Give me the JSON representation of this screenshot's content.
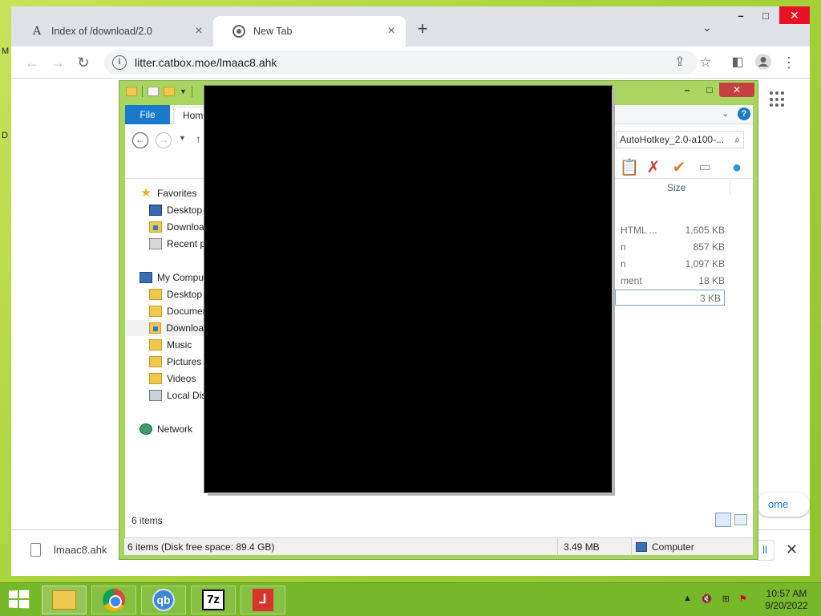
{
  "browser": {
    "tabs": [
      {
        "label": "Index of /download/2.0",
        "favicon": "A"
      },
      {
        "label": "New Tab"
      }
    ],
    "url": "litter.catbox.moe/lmaac8.ahk",
    "customize_label": "ome",
    "download": {
      "filename": "lmaac8.ahk"
    }
  },
  "explorer": {
    "ribbon": {
      "file": "File",
      "home": "Home"
    },
    "address": "AutoHotkey_2.0-a100-...",
    "column_size": "Size",
    "tree": {
      "favorites": "Favorites",
      "fav_desktop": "Desktop",
      "fav_downloads": "Downloa",
      "fav_recent": "Recent pl",
      "computer": "My Compu",
      "desktop": "Desktop",
      "documents": "Documen",
      "downloads": "Downloa",
      "music": "Music",
      "pictures": "Pictures",
      "videos": "Videos",
      "local_disk": "Local Dis",
      "network": "Network"
    },
    "rows": [
      {
        "type": "HTML ...",
        "size": "1,605 KB"
      },
      {
        "type": "n",
        "size": "857 KB"
      },
      {
        "type": "n",
        "size": "1,097 KB"
      },
      {
        "type": "ment",
        "size": "18 KB"
      },
      {
        "type": "",
        "size": "3 KB"
      }
    ],
    "status_items": "6 items",
    "details": {
      "summary": "6 items (Disk free space: 89.4 GB)",
      "size": "3.49 MB",
      "location": "Computer"
    }
  },
  "taskbar": {
    "time": "10:57 AM",
    "date": "9/20/2022",
    "apps": [
      "file-explorer",
      "chrome",
      "qbittorrent",
      "7-zip",
      "pdf-app"
    ]
  },
  "desktop": {
    "icon_letter_1": "M",
    "icon_letter_2": "D"
  },
  "colors": {
    "taskbar": "#76b82a",
    "explorer_frame": "#a8d560",
    "accent_blue": "#1979ca"
  }
}
